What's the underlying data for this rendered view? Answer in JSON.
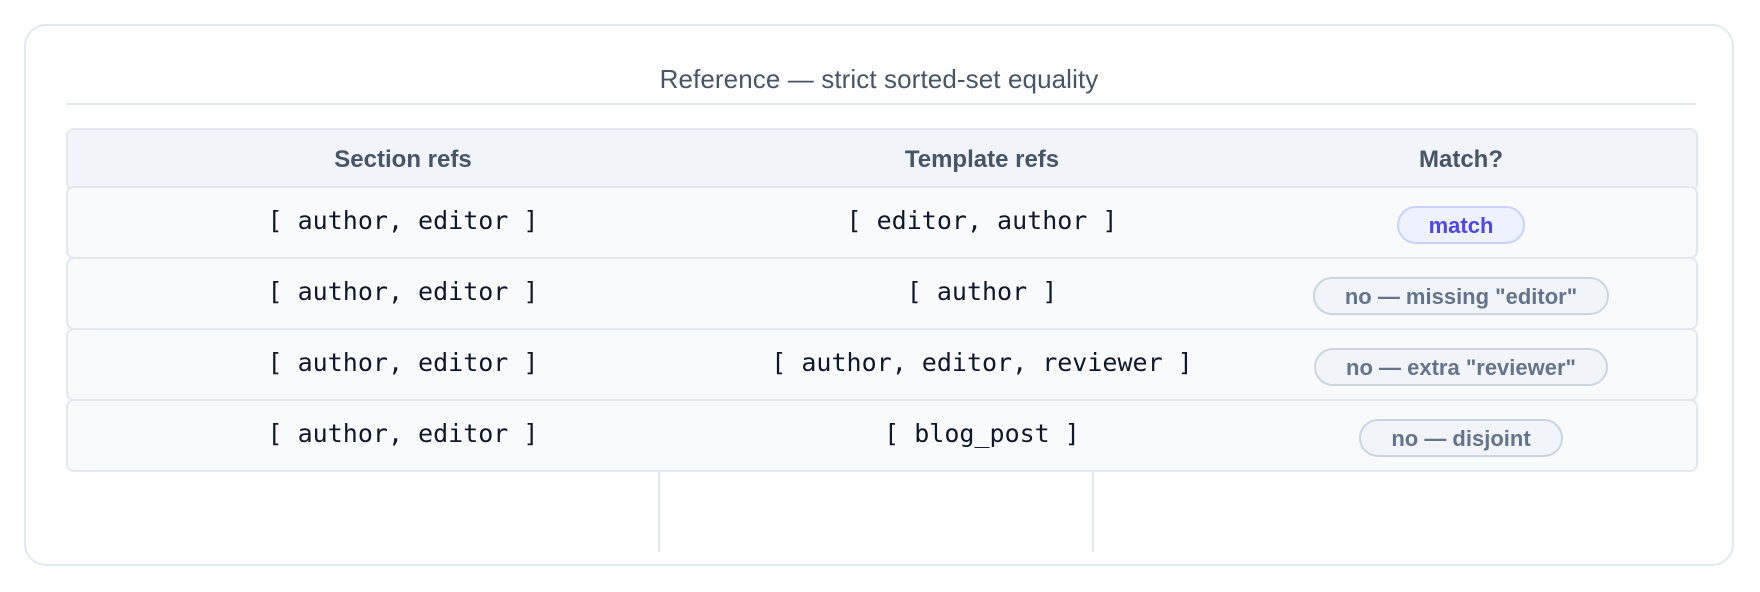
{
  "title": "Reference — strict sorted-set equality",
  "table": {
    "headers": [
      "Section refs",
      "Template refs",
      "Match?"
    ],
    "rows": [
      {
        "section_refs": "[ author, editor ]",
        "template_refs": "[ editor, author ]",
        "match": "match",
        "status": "match"
      },
      {
        "section_refs": "[ author, editor ]",
        "template_refs": "[ author ]",
        "match": "no — missing \"editor\"",
        "status": "no"
      },
      {
        "section_refs": "[ author, editor ]",
        "template_refs": "[ author, editor, reviewer ]",
        "match": "no — extra \"reviewer\"",
        "status": "no"
      },
      {
        "section_refs": "[ author, editor ]",
        "template_refs": "[ blog_post ]",
        "match": "no — disjoint",
        "status": "no"
      }
    ]
  },
  "colors": {
    "match_badge_text": "#4f46e5",
    "match_badge_bg": "#eef2ff",
    "no_badge_text": "#64748b",
    "no_badge_bg": "#f1f5f9"
  }
}
